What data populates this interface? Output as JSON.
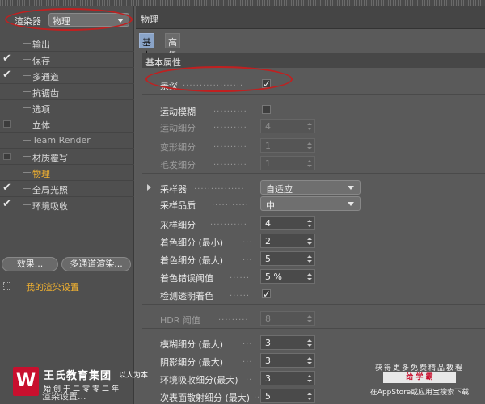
{
  "renderer": {
    "label": "渲染器",
    "value": "物理"
  },
  "sidebar": {
    "items": [
      {
        "label": "输出",
        "indicator": "none",
        "state": "normal"
      },
      {
        "label": "保存",
        "indicator": "check",
        "state": "normal"
      },
      {
        "label": "多通道",
        "indicator": "check",
        "state": "normal"
      },
      {
        "label": "抗锯齿",
        "indicator": "none",
        "state": "normal"
      },
      {
        "label": "选项",
        "indicator": "none",
        "state": "normal"
      },
      {
        "label": "立体",
        "indicator": "box",
        "state": "normal"
      },
      {
        "label": "Team Render",
        "indicator": "none",
        "state": "disabled"
      },
      {
        "label": "材质覆写",
        "indicator": "box",
        "state": "normal"
      },
      {
        "label": "物理",
        "indicator": "none",
        "state": "active"
      },
      {
        "label": "全局光照",
        "indicator": "check",
        "state": "normal"
      },
      {
        "label": "环境吸收",
        "indicator": "check",
        "state": "normal"
      }
    ],
    "effects_button": "效果...",
    "multipass_button": "多通道渲染...",
    "preset_label": "我的渲染设置",
    "bottom_item": "渲染设置..."
  },
  "panel": {
    "title": "物理",
    "tabs": [
      {
        "label": "基本",
        "active": true
      },
      {
        "label": "高级",
        "active": false
      }
    ],
    "group_title": "基本属性",
    "rows": [
      {
        "label": "景深",
        "type": "checkbox",
        "checked": true,
        "enabled": true
      },
      {
        "label": "运动模糊",
        "type": "checkbox",
        "checked": false,
        "enabled": true
      },
      {
        "label": "运动细分",
        "type": "spinner",
        "value": "4",
        "enabled": false
      },
      {
        "label": "变形细分",
        "type": "spinner",
        "value": "1",
        "enabled": false
      },
      {
        "label": "毛发细分",
        "type": "spinner",
        "value": "1",
        "enabled": false
      },
      {
        "label": "采样器",
        "type": "dropdown",
        "value": "自适应",
        "enabled": true
      },
      {
        "label": "采样品质",
        "type": "dropdown",
        "value": "中",
        "enabled": true
      },
      {
        "label": "采样细分",
        "type": "spinner",
        "value": "4",
        "enabled": true
      },
      {
        "label": "着色细分 (最小)",
        "type": "spinner",
        "value": "2",
        "enabled": true
      },
      {
        "label": "着色细分 (最大)",
        "type": "spinner",
        "value": "5",
        "enabled": true
      },
      {
        "label": "着色错误阈值",
        "type": "spinner",
        "value": "5 %",
        "enabled": true
      },
      {
        "label": "检测透明着色",
        "type": "checkbox",
        "checked": true,
        "enabled": true
      },
      {
        "label": "HDR 阈值",
        "type": "spinner",
        "value": "8",
        "enabled": false
      },
      {
        "label": "模糊细分 (最大)",
        "type": "spinner",
        "value": "3",
        "enabled": true
      },
      {
        "label": "阴影细分 (最大)",
        "type": "spinner",
        "value": "3",
        "enabled": true
      },
      {
        "label": "环境吸收细分(最大)",
        "type": "spinner",
        "value": "3",
        "enabled": true
      },
      {
        "label": "次表面散射细分 (最大)",
        "type": "spinner",
        "value": "5",
        "enabled": true
      }
    ]
  },
  "watermark_left": {
    "logo": "W",
    "name": "王氏教育集团",
    "slogan": "以人为本",
    "sub": "始创于二零零二年"
  },
  "watermark_right": {
    "line1": "获得更多免费精品教程",
    "line2": "给 学 霸",
    "line3": "在AppStore或应用宝搜索下载"
  },
  "accent_colors": {
    "highlight_red": "#c02020",
    "active_orange": "#f0b030",
    "tab_blue": "#8aa4c8"
  }
}
